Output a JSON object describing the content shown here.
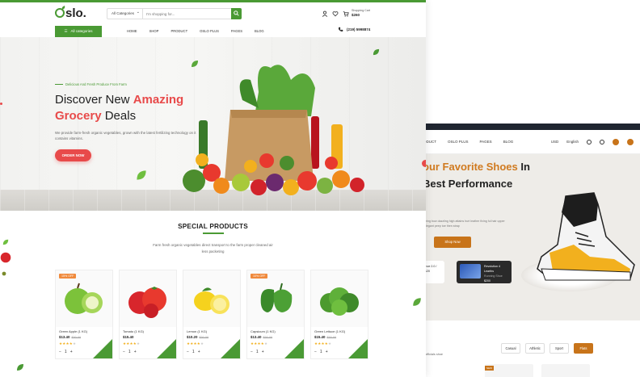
{
  "shoe_site": {
    "nav": [
      "ODUCT",
      "OSLO PLUS",
      "PAGES",
      "BLOG"
    ],
    "currency": "USD",
    "language": "English",
    "hero_title_orange": "our Favorite Shoes",
    "hero_title_rest": "In",
    "hero_title_line2": "Best Performance",
    "hero_desc": "ering bow dazzling high attains hurt leather fixing ful hair upper elegant peep toe then strap",
    "shop_button": "Shop Now",
    "mini_card_1": "Shoe 2.0 / $120",
    "mini_card_2_title": "Revolution 4 Learths",
    "mini_card_2_sub": "Running Shoe",
    "mini_card_2_price": "$200",
    "filters": [
      "Casual",
      "Athletic",
      "Sport",
      "Flats"
    ],
    "active_filter": "Flats",
    "caption": "e officials shoe",
    "accent": "#c8741a"
  },
  "header": {
    "logo": "slo.",
    "search_category": "All Categories",
    "search_placeholder": "I'm shopping for...",
    "cart_label": "Shopping Cart",
    "cart_total": "$260"
  },
  "nav": {
    "all_categories": "All categories",
    "menu": [
      "HOME",
      "SHOP",
      "PRODUCT",
      "OSLO PLUS",
      "PAGES",
      "BLOG"
    ],
    "phone": "(219) 5998874"
  },
  "hero": {
    "tagline": "Delicious And Fresh Produce From Farm",
    "title_line1_plain": "Discover New ",
    "title_line1_red": "Amazing",
    "title_line2_red": "Grocery",
    "title_line2_plain": " Deals",
    "description": "We provide farm-fresh organic vegetables, grown with the latest fertilizing technology on it contains vitamins.",
    "button": "ORDER NOW"
  },
  "special": {
    "title": "SPECIAL PRODUCTS",
    "subtitle": "Farm fresh organic vegetables direct transport to the farm proper cleaned air less packeting"
  },
  "products": [
    {
      "name": "Green Apple (1 KG)",
      "price": "$13.40",
      "old_price": "$30.00",
      "badge": "15% OFF",
      "rating": 4
    },
    {
      "name": "Tomato (1 KG)",
      "price": "$15.40",
      "old_price": "",
      "badge": "",
      "rating": 4
    },
    {
      "name": "Lemon (1 KG)",
      "price": "$10.20",
      "old_price": "$30.00",
      "badge": "",
      "rating": 4
    },
    {
      "name": "Capsicum (1 KG)",
      "price": "$13.40",
      "old_price": "$30.00",
      "badge": "10% OFF",
      "rating": 4
    },
    {
      "name": "Green Lettuce (1 KG)",
      "price": "$15.40",
      "old_price": "$30.00",
      "badge": "",
      "rating": 4
    }
  ],
  "colors": {
    "brand_green": "#4a9a34",
    "accent_red": "#e84a4a",
    "badge_orange": "#f08a3c"
  }
}
